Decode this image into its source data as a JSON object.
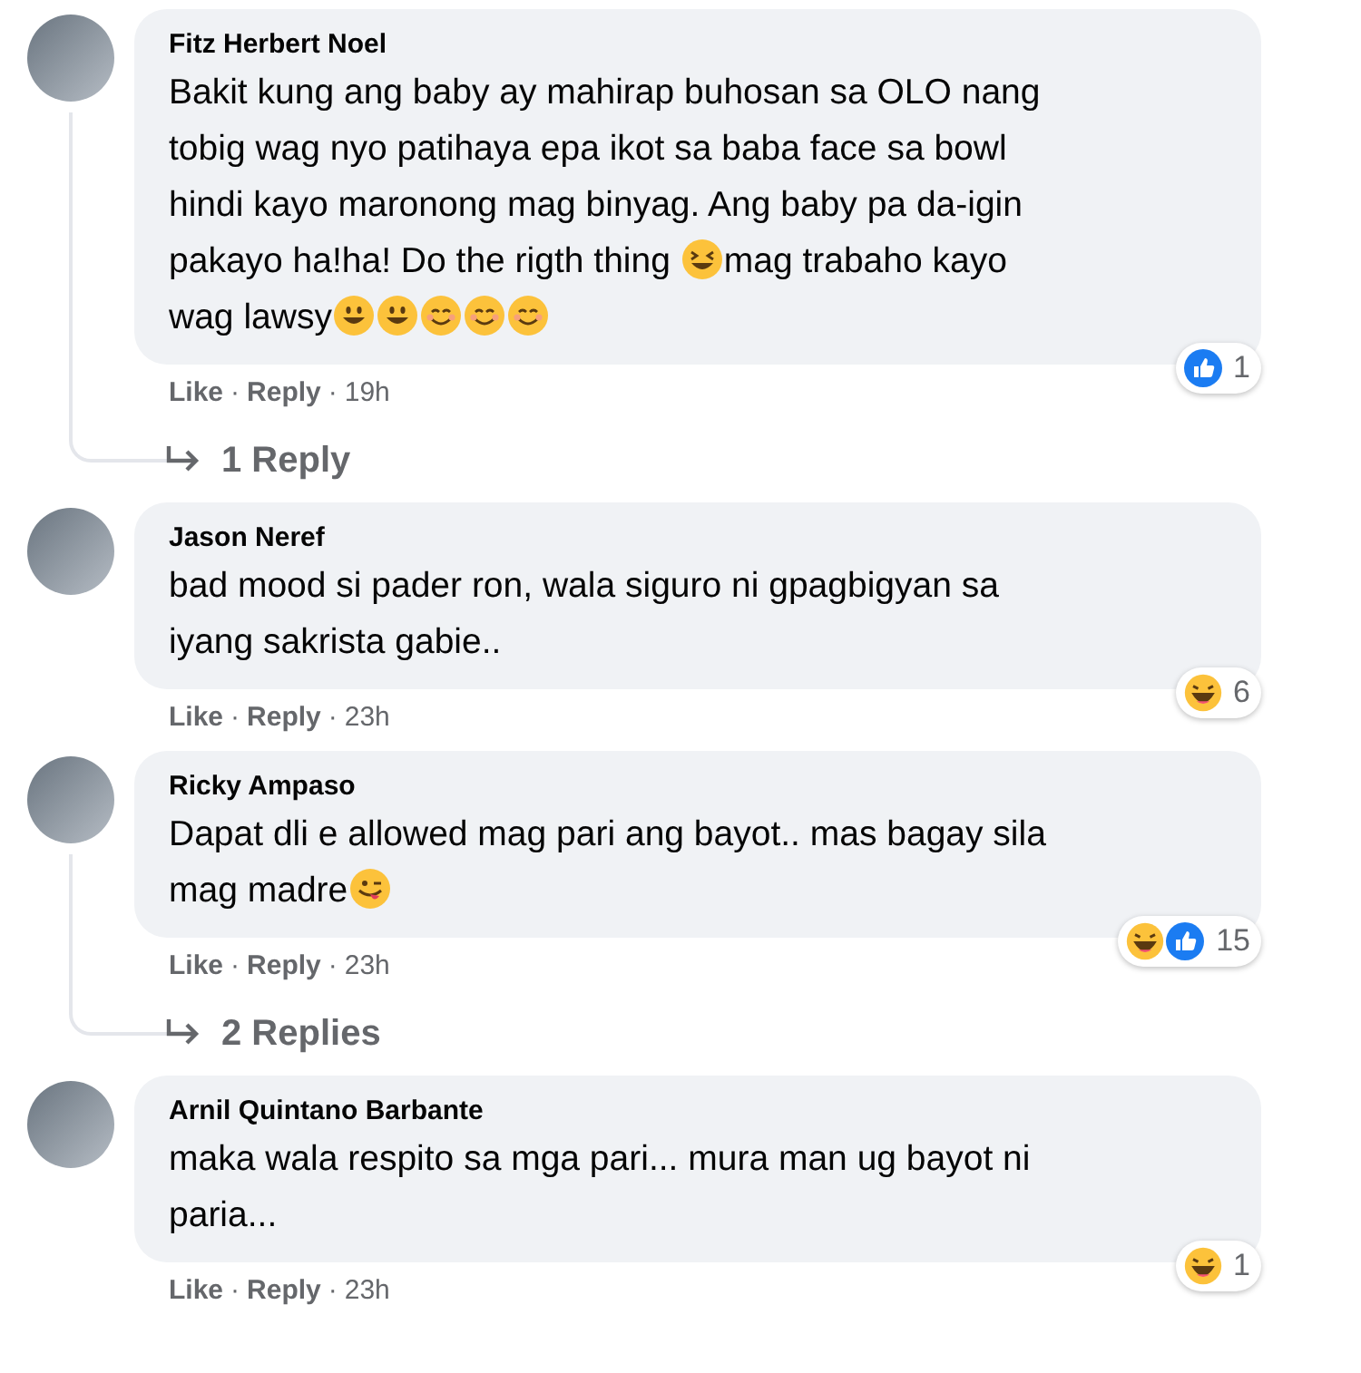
{
  "comments": [
    {
      "author": "Fitz Herbert Noel",
      "lines": [
        [
          {
            "kind": "text",
            "text": "Bakit kung ang baby ay mahirap buhosan sa OLO nang"
          }
        ],
        [
          {
            "kind": "text",
            "text": "tobig wag nyo patihaya epa ikot sa baba face sa bowl"
          }
        ],
        [
          {
            "kind": "text",
            "text": "hindi kayo maronong mag binyag. Ang baby pa da-igin"
          }
        ],
        [
          {
            "kind": "text",
            "text": "pakayo ha!ha! Do the rigth thing "
          },
          {
            "kind": "squint"
          },
          {
            "kind": "text",
            "text": "mag trabaho kayo"
          }
        ],
        [
          {
            "kind": "text",
            "text": "wag lawsy"
          },
          {
            "kind": "grin"
          },
          {
            "kind": "grin"
          },
          {
            "kind": "smile"
          },
          {
            "kind": "smile"
          },
          {
            "kind": "smile"
          }
        ]
      ],
      "meta": [
        {
          "kind": "link",
          "text": "Like"
        },
        {
          "kind": "separator",
          "text": "·"
        },
        {
          "kind": "link",
          "text": "Reply"
        },
        {
          "kind": "separator",
          "text": "·"
        },
        {
          "kind": "time",
          "text": "19h"
        }
      ],
      "reactions": [
        {
          "kind": "like"
        }
      ],
      "reaction_count": "1",
      "replies": "1 Reply"
    },
    {
      "author": "Jason Neref",
      "lines": [
        [
          {
            "kind": "text",
            "text": "bad mood si pader ron, wala siguro ni gpagbigyan sa"
          }
        ],
        [
          {
            "kind": "text",
            "text": "iyang sakrista gabie.."
          }
        ]
      ],
      "meta": [
        {
          "kind": "link",
          "text": "Like"
        },
        {
          "kind": "separator",
          "text": "·"
        },
        {
          "kind": "link",
          "text": "Reply"
        },
        {
          "kind": "separator",
          "text": "·"
        },
        {
          "kind": "time",
          "text": "23h"
        }
      ],
      "reactions": [
        {
          "kind": "haha"
        }
      ],
      "reaction_count": "6"
    },
    {
      "author": "Ricky Ampaso",
      "lines": [
        [
          {
            "kind": "text",
            "text": "Dapat dli e allowed mag pari ang bayot.. mas bagay sila"
          }
        ],
        [
          {
            "kind": "text",
            "text": "mag madre"
          },
          {
            "kind": "wink"
          }
        ]
      ],
      "meta": [
        {
          "kind": "link",
          "text": "Like"
        },
        {
          "kind": "separator",
          "text": "·"
        },
        {
          "kind": "link",
          "text": "Reply"
        },
        {
          "kind": "separator",
          "text": "·"
        },
        {
          "kind": "time",
          "text": "23h"
        }
      ],
      "reactions": [
        {
          "kind": "haha"
        },
        {
          "kind": "like"
        }
      ],
      "reaction_count": "15",
      "replies": "2 Replies"
    },
    {
      "author": "Arnil Quintano Barbante",
      "lines": [
        [
          {
            "kind": "text",
            "text": "maka wala respito sa mga pari... mura man ug bayot ni"
          }
        ],
        [
          {
            "kind": "text",
            "text": "paria..."
          }
        ]
      ],
      "meta": [
        {
          "kind": "link",
          "text": "Like"
        },
        {
          "kind": "separator",
          "text": "·"
        },
        {
          "kind": "link",
          "text": "Reply"
        },
        {
          "kind": "separator",
          "text": "·"
        },
        {
          "kind": "time",
          "text": "23h"
        }
      ],
      "reactions": [
        {
          "kind": "haha"
        }
      ],
      "reaction_count": "1"
    }
  ]
}
